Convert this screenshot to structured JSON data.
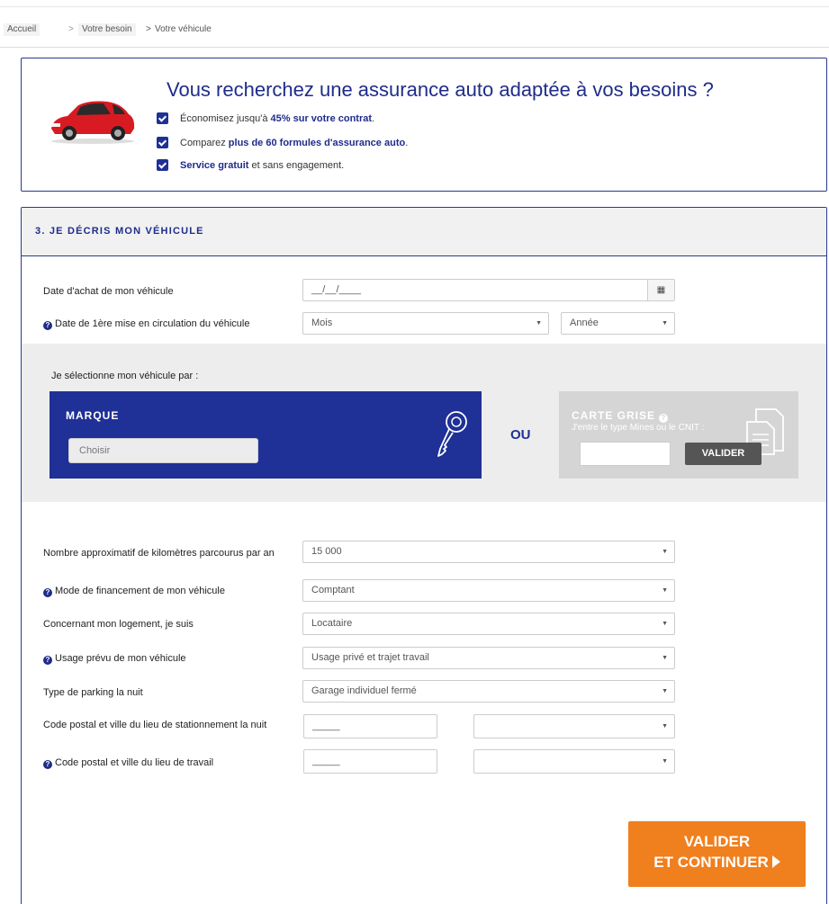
{
  "breadcrumb": {
    "home": "Accueil",
    "sep1": ">",
    "step1": "Votre besoin",
    "sep2": ">",
    "current": "Votre véhicule"
  },
  "promo": {
    "title": "Vous recherchez une assurance auto adaptée à vos besoins ?",
    "item1_pre": "Économisez jusqu'à ",
    "item1_bold": "45% sur votre contrat",
    "item1_post": ".",
    "item2_pre": "Comparez ",
    "item2_bold": "plus de 60 formules d'assurance auto",
    "item2_post": ".",
    "item3_bold": "Service gratuit",
    "item3_post": " et sans engagement."
  },
  "form": {
    "section_title": "3. JE DÉCRIS MON VÉHICULE",
    "date_achat_label": "Date d'achat de mon véhicule",
    "date_achat_value": "__/__/____",
    "date_circ_label": "Date de 1ère mise en circulation du véhicule",
    "mois_value": "Mois",
    "annee_value": "Année",
    "selection_label": "Je sélectionne mon véhicule par :",
    "marque_title": "MARQUE",
    "marque_select": "Choisir",
    "ou": "OU",
    "carte_title": "CARTE GRISE",
    "carte_sub": "J'entre le type Mines ou le CNIT :",
    "carte_button": "VALIDER",
    "km_label": "Nombre approximatif de kilomètres parcourus par an",
    "km_value": "15 000",
    "financement_label": "Mode de financement de mon véhicule",
    "financement_value": "Comptant",
    "logement_label": "Concernant mon logement, je suis",
    "logement_value": "Locataire",
    "usage_label": "Usage prévu de mon véhicule",
    "usage_value": "Usage privé et trajet travail",
    "parking_label": "Type de parking la nuit",
    "parking_value": "Garage individuel fermé",
    "cp_station_label": "Code postal et ville du lieu de stationnement la nuit",
    "cp_station_value": "_____",
    "cp_travail_label": "Code postal et ville du lieu de travail",
    "cp_travail_value": "_____",
    "submit_line1": "VALIDER",
    "submit_line2": "ET CONTINUER"
  },
  "icons": {
    "caret": "▼",
    "calendar": "▦",
    "question": "?"
  },
  "colors": {
    "brand_blue": "#1f3096",
    "accent_orange": "#f07f1e",
    "panel_grey": "#ededed"
  }
}
